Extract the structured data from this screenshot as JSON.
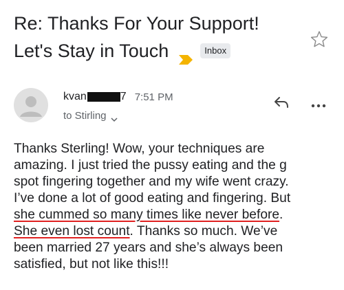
{
  "email": {
    "subject_line1": "Re: Thanks For Your Support!",
    "subject_line2": "Let's Stay in Touch",
    "label": "Inbox",
    "sender_name": "kvan",
    "sender_suffix": "7",
    "time": "7:51 PM",
    "to": "to Stirling",
    "body_lines": [
      "Thanks Sterling! Wow, your techniques are",
      "amazing. I just tried the pussy eating and the g",
      "spot fingering together and my wife went crazy.",
      "I’ve done a lot of good eating and fingering. But"
    ],
    "line5_underlined": "she cummed so many times like never before",
    "line5_rest": ".",
    "line6_underlined": "She even lost count",
    "line6_rest": ". Thanks so much. We’ve",
    "body_tail": [
      "been married 27 years and she’s always been",
      "satisfied, but not like this!!!"
    ]
  },
  "icons": {
    "important": "important-marker-icon",
    "star": "star-icon",
    "avatar": "avatar-icon",
    "reply": "reply-icon",
    "more": "more-options-icon",
    "chevron": "chevron-down-icon"
  },
  "colors": {
    "important_marker": "#f4b400",
    "underline": "#e02020",
    "badge_bg": "#e8eaed"
  }
}
